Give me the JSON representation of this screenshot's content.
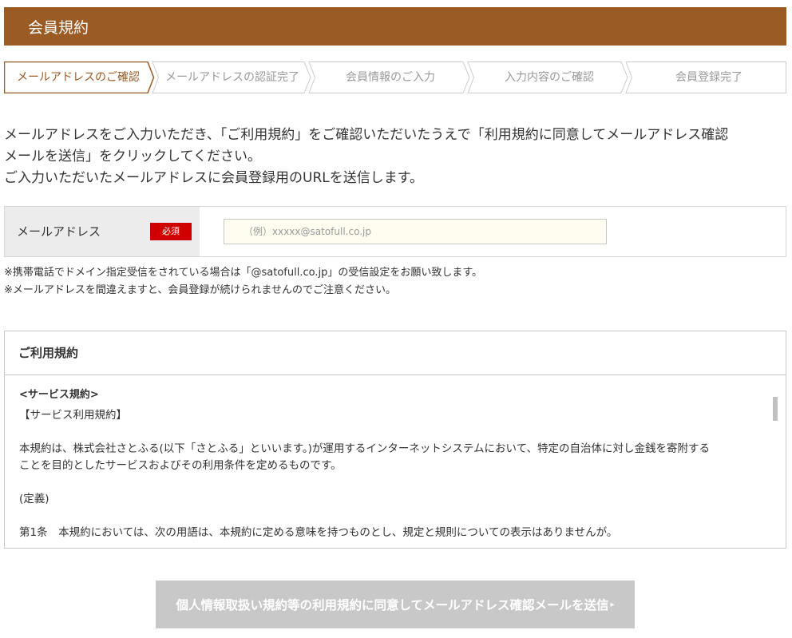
{
  "page": {
    "title": "会員規約"
  },
  "steps": [
    {
      "label": "メールアドレスのご確認",
      "active": true
    },
    {
      "label": "メールアドレスの認証完了",
      "active": false
    },
    {
      "label": "会員情報のご入力",
      "active": false
    },
    {
      "label": "入力内容のご確認",
      "active": false
    },
    {
      "label": "会員登録完了",
      "active": false
    }
  ],
  "intro": {
    "line1": "メールアドレスをご入力いただき、「ご利用規約」をご確認いただいたうえで「利用規約に同意してメールアドレス確認",
    "line2": "メールを送信」をクリックしてください。",
    "line3": "ご入力いただいたメールアドレスに会員登録用のURLを送信します。"
  },
  "email_field": {
    "label": "メールアドレス",
    "required_badge": "必須",
    "placeholder": "（例）xxxxx@satofull.co.jp",
    "value": ""
  },
  "notes": [
    "※携帯電話でドメイン指定受信をされている場合は「@satofull.co.jp」の受信設定をお願い致します。",
    "※メールアドレスを間違えますと、会員登録が続けられませんのでご注意ください。"
  ],
  "terms": {
    "heading": "ご利用規約",
    "section_title": "<サービス規約>",
    "subsection_title": "【サービス利用規約】",
    "paragraph_line1": "本規約は、株式会社さとふる(以下「さとふる」といいます。)が運用するインターネットシステムにおいて、特定の自治体に対し金銭を寄附する",
    "paragraph_line2": "ことを目的としたサービスおよびその利用条件を定めるものです。",
    "definitions_title": "(定義)",
    "partial_line": "第1条　本規約においては、次の用語は、本規約に定める意味を持つものとし、規定と規則についての表示はありませんが。"
  },
  "submit": {
    "label": "個人情報取扱い規約等の利用規約に同意してメールアドレス確認メールを送信",
    "arrow": "▸"
  },
  "colors": {
    "brand": "#9a5b25",
    "required": "#d10000",
    "disabled_button": "#c8c8c8"
  }
}
